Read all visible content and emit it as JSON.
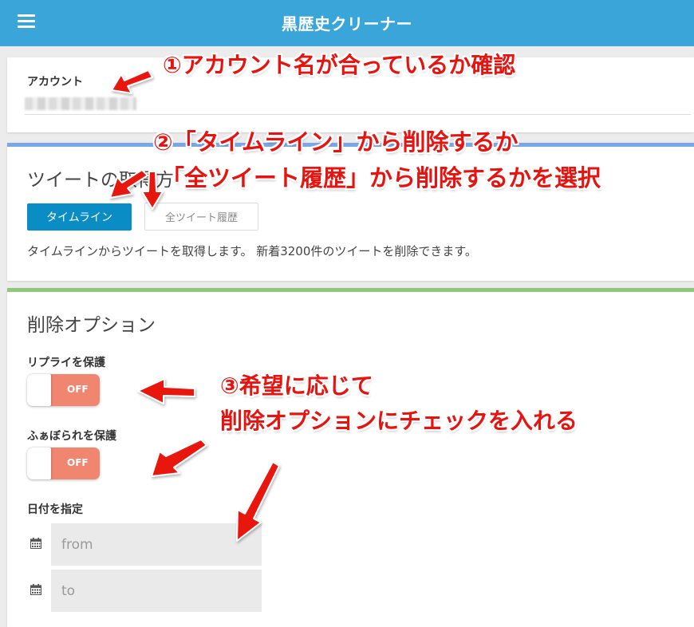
{
  "app": {
    "title": "黒歴史クリーナー",
    "menu_icon": "hamburger-menu-icon"
  },
  "account": {
    "label": "アカウント",
    "value_obscured": true
  },
  "tweet_source": {
    "title": "ツイートの取得方",
    "button_timeline": "タイムライン",
    "button_all_history": "全ツイート履歴",
    "selected": "タイムライン",
    "description": "タイムラインからツイートを取得します。 新着3200件のツイートを削除できます。"
  },
  "delete_options": {
    "title": "削除オプション",
    "protect_replies_label": "リプライを保護",
    "protect_replies_state": "OFF",
    "protect_favorited_label": "ふぁぼられを保護",
    "protect_favorited_state": "OFF",
    "date_label": "日付を指定",
    "from_placeholder": "from",
    "to_placeholder": "to",
    "calendar_icon": "calendar-icon"
  },
  "annotations": {
    "note1": "①アカウント名が合っているか確認",
    "note2_line1": "②「タイムライン」から削除するか",
    "note2_line2": "「全ツイート履歴」から削除するかを選択",
    "note3_line1": "③希望に応じて",
    "note3_line2": "削除オプションにチェックを入れる"
  },
  "colors": {
    "header": "#3aa5d8",
    "primary_button": "#0a8cc4",
    "toggle_off": "#f08570",
    "card2_accent": "#7aa7e8",
    "card3_accent": "#8cc97a",
    "annotation": "#e8130f"
  }
}
